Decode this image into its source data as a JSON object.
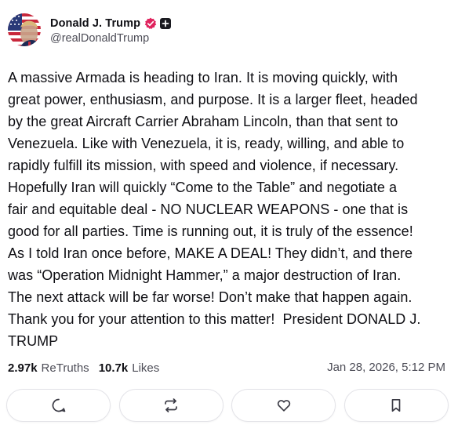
{
  "author": {
    "display_name": "Donald J. Trump",
    "handle": "@realDonaldTrump",
    "avatar_icon": "avatar-flag-portrait",
    "verified_icon": "verified-badge-icon",
    "verified_color": "#e0245e",
    "extra_badge_icon": "plus-badge-icon"
  },
  "post": {
    "text": "A massive Armada is heading to Iran. It is moving quickly, with\ngreat power, enthusiasm, and purpose. It is a larger fleet, headed\nby the great Aircraft Carrier Abraham Lincoln, than that sent to\nVenezuela. Like with Venezuela, it is, ready, willing, and able to\nrapidly fulfill its mission, with speed and violence, if necessary.\nHopefully Iran will quickly “Come to the Table” and negotiate a\nfair and equitable deal - NO NUCLEAR WEAPONS - one that is\ngood for all parties. Time is running out, it is truly of the essence!\nAs I told Iran once before, MAKE A DEAL! They didn’t, and there\nwas “Operation Midnight Hammer,” a major destruction of Iran.\nThe next attack will be far worse! Don’t make that happen again.\nThank you for your attention to this matter!  President DONALD J.\nTRUMP"
  },
  "stats": {
    "retruths_count": "2.97k",
    "retruths_label": "ReTruths",
    "likes_count": "10.7k",
    "likes_label": "Likes",
    "timestamp": "Jan 28, 2026, 5:12 PM"
  },
  "actions": [
    {
      "name": "reply",
      "icon": "comment-icon"
    },
    {
      "name": "retruth",
      "icon": "retruth-icon"
    },
    {
      "name": "like",
      "icon": "heart-icon"
    },
    {
      "name": "bookmark",
      "icon": "bookmark-icon"
    }
  ],
  "colors": {
    "text": "#0f0f14",
    "muted": "#4d4d57",
    "border": "#e3e3e8",
    "icon": "#3b3b45"
  }
}
